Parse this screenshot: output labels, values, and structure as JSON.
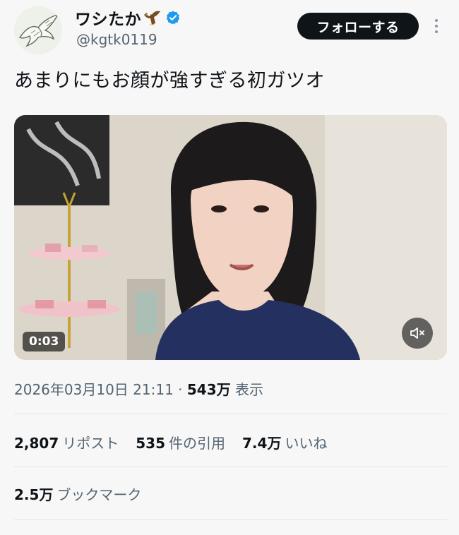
{
  "author": {
    "display_name": "ワシたか",
    "handle": "@kgtk0119",
    "avatar": "eagle-illustration",
    "badge": "verified-check-icon"
  },
  "actions": {
    "follow_label": "フォローする",
    "more": "more-options-icon"
  },
  "tweet": {
    "text": "あまりにもお顔が強すぎる初ガツオ"
  },
  "video": {
    "duration": "0:03",
    "muted": true,
    "mute_icon": "speaker-muted-icon"
  },
  "meta": {
    "datetime": "2026年03月10日 21:11",
    "separator": "·",
    "views_count": "543万",
    "views_label": "表示"
  },
  "stats": {
    "reposts_count": "2,807",
    "reposts_label": "リポスト",
    "quotes_count": "535",
    "quotes_label": "件の引用",
    "likes_count": "7.4万",
    "likes_label": "いいね",
    "bookmarks_count": "2.5万",
    "bookmarks_label": "ブックマーク"
  },
  "colors": {
    "text_primary": "#0f1419",
    "text_secondary": "#536471",
    "verified_blue": "#1d9bf0",
    "follow_bg": "#0f1419"
  }
}
